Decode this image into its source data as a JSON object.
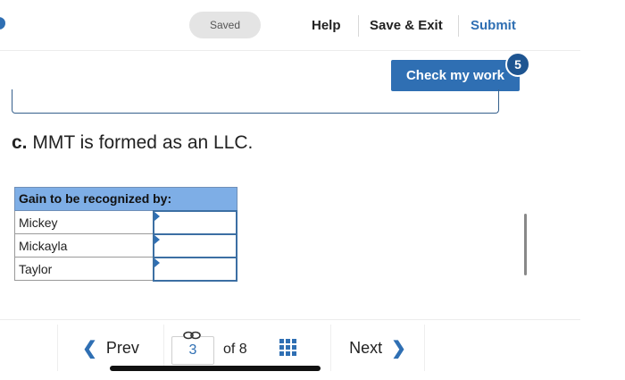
{
  "header": {
    "saved_label": "Saved",
    "help_label": "Help",
    "save_exit_label": "Save & Exit",
    "submit_label": "Submit",
    "colors": {
      "accent": "#2f6fb3",
      "submit": "#2f6fb3"
    }
  },
  "check_work": {
    "label": "Check my work",
    "badge_count": "5"
  },
  "question": {
    "letter": "c.",
    "text": "MMT is formed as an LLC."
  },
  "table": {
    "header": "Gain to be recognized by:",
    "rows": [
      {
        "name": "Mickey",
        "value": ""
      },
      {
        "name": "Mickayla",
        "value": ""
      },
      {
        "name": "Taylor",
        "value": ""
      }
    ],
    "header_color": "#7eaee6"
  },
  "nav": {
    "prev_label": "Prev",
    "page_current": "3",
    "page_of": "of 8",
    "next_label": "Next"
  }
}
